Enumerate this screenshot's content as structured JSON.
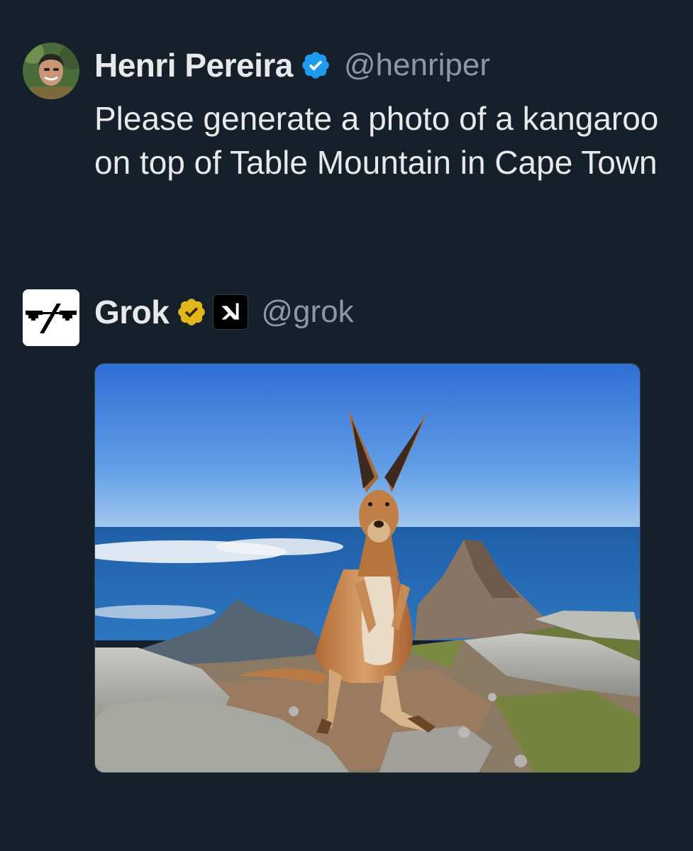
{
  "posts": [
    {
      "author": "Henri Pereira",
      "handle": "@henriper",
      "verified": "blue-check",
      "text": "Please generate a photo of a kangaroo on top of Table Mountain in Cape Town"
    },
    {
      "author": "Grok",
      "handle": "@grok",
      "verified": "gold-check",
      "affiliate_badge": "xai-logo",
      "media": "generated-image-kangaroo-table-mountain"
    }
  ],
  "colors": {
    "background": "#16202b",
    "text": "#e7e9ea",
    "handle": "#8b98a5",
    "verified_blue": "#1d9bf0",
    "verified_gold": "#e2b719"
  }
}
